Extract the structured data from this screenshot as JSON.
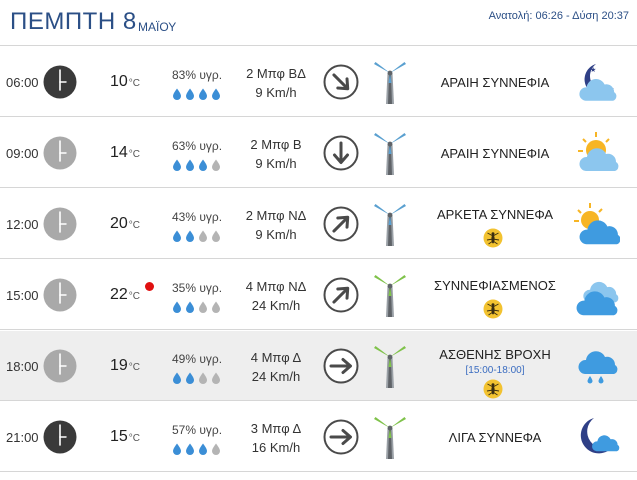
{
  "header": {
    "day": "ΠΕΜΠΤΗ 8",
    "month": "ΜΑΪΟΥ",
    "sun_times": "Ανατολή: 06:26 - Δύση 20:37"
  },
  "colors": {
    "header_text": "#2b4f86",
    "clock_night": "#3a3a3a",
    "clock_day": "#a9a9a9",
    "drop_filled": "#3b8ed6",
    "drop_empty": "#b4b4b4",
    "turbine_calm": "#5aa0d0",
    "turbine_breezy": "#7fc24a",
    "max_temp_marker": "#e01010",
    "mosquito_badge": "#f2c230"
  },
  "rows": [
    {
      "time": "06:00",
      "clock": "night",
      "temp": "10",
      "unit": "°C",
      "max_marker": false,
      "humidity": "83% υγρ.",
      "drops": 4,
      "wind_bf": "2 Μπφ ΒΔ",
      "wind_kmh": "9 Km/h",
      "wind_icon": "wind-arrow-southeast-icon",
      "turbine": "calm",
      "condition": "ΑΡΑΙΗ ΣΥΝΝΕΦΙΑ",
      "mosquito": false,
      "rain_period": "",
      "weather": "night-partly-cloudy-icon"
    },
    {
      "time": "09:00",
      "clock": "day",
      "temp": "14",
      "unit": "°C",
      "max_marker": false,
      "humidity": "63% υγρ.",
      "drops": 3,
      "wind_bf": "2 Μπφ Β",
      "wind_kmh": "9 Km/h",
      "wind_icon": "wind-arrow-south-icon",
      "turbine": "calm",
      "condition": "ΑΡΑΙΗ ΣΥΝΝΕΦΙΑ",
      "mosquito": false,
      "rain_period": "",
      "weather": "day-partly-cloudy-icon"
    },
    {
      "time": "12:00",
      "clock": "day",
      "temp": "20",
      "unit": "°C",
      "max_marker": false,
      "humidity": "43% υγρ.",
      "drops": 2,
      "wind_bf": "2 Μπφ ΝΔ",
      "wind_kmh": "9 Km/h",
      "wind_icon": "wind-arrow-northeast-icon",
      "turbine": "calm",
      "condition": "ΑΡΚΕΤΑ ΣΥΝΝΕΦΑ",
      "mosquito": true,
      "rain_period": "",
      "weather": "sun-behind-cloud-icon"
    },
    {
      "time": "15:00",
      "clock": "day",
      "temp": "22",
      "unit": "°C",
      "max_marker": true,
      "humidity": "35% υγρ.",
      "drops": 2,
      "wind_bf": "4 Μπφ ΝΔ",
      "wind_kmh": "24 Km/h",
      "wind_icon": "wind-arrow-northeast-icon",
      "turbine": "breezy",
      "condition": "ΣΥΝΝΕΦΙΑΣΜΕΝΟΣ",
      "mosquito": true,
      "rain_period": "",
      "weather": "overcast-clouds-icon"
    },
    {
      "time": "18:00",
      "clock": "day",
      "temp": "19",
      "unit": "°C",
      "max_marker": false,
      "humidity": "49% υγρ.",
      "drops": 2,
      "wind_bf": "4 Μπφ Δ",
      "wind_kmh": "24 Km/h",
      "wind_icon": "wind-arrow-east-icon",
      "turbine": "breezy",
      "condition": "ΑΣΘΕΝΗΣ ΒΡΟΧΗ",
      "mosquito": true,
      "rain_period": "[15:00-18:00]",
      "weather": "rain-cloud-icon"
    },
    {
      "time": "21:00",
      "clock": "night",
      "temp": "15",
      "unit": "°C",
      "max_marker": false,
      "humidity": "57% υγρ.",
      "drops": 3,
      "wind_bf": "3 Μπφ Δ",
      "wind_kmh": "16 Km/h",
      "wind_icon": "wind-arrow-east-icon",
      "turbine": "breezy",
      "condition": "ΛΙΓΑ ΣΥΝΝΕΦΑ",
      "mosquito": false,
      "rain_period": "",
      "weather": "moon-small-cloud-icon"
    }
  ]
}
